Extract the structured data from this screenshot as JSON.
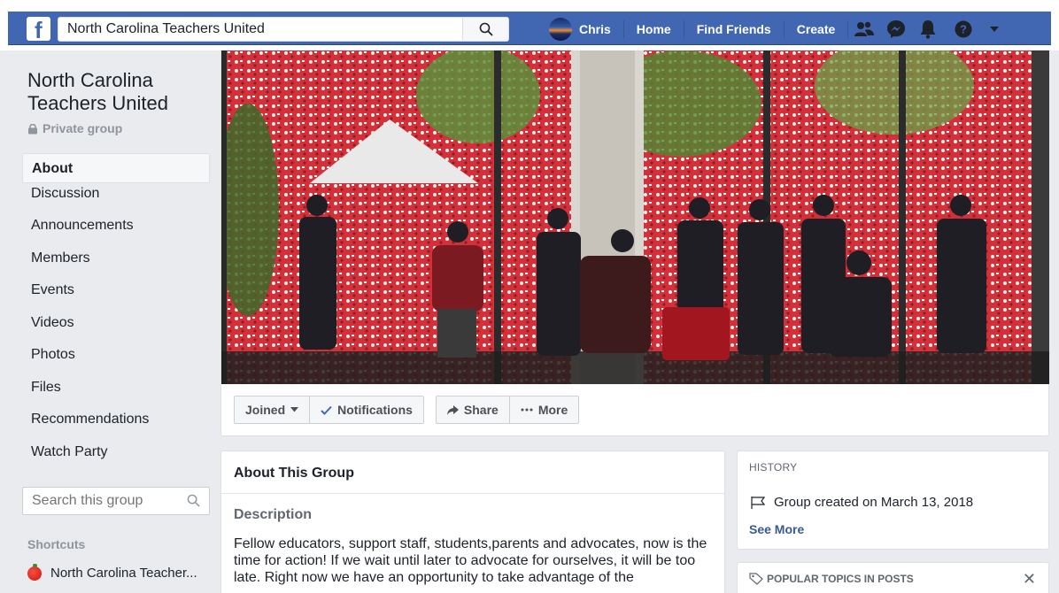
{
  "topbar": {
    "search_value": "North Carolina Teachers United",
    "user_name": "Chris",
    "links": [
      "Home",
      "Find Friends",
      "Create"
    ],
    "brand_color": "#4267b2"
  },
  "group": {
    "name": "North Carolina Teachers United",
    "privacy": "Private group"
  },
  "sidebar": {
    "items": [
      {
        "label": "About",
        "active": true
      },
      {
        "label": "Discussion"
      },
      {
        "label": "Announcements"
      },
      {
        "label": "Members"
      },
      {
        "label": "Events"
      },
      {
        "label": "Videos"
      },
      {
        "label": "Photos"
      },
      {
        "label": "Files"
      },
      {
        "label": "Recommendations"
      },
      {
        "label": "Watch Party"
      }
    ],
    "search_placeholder": "Search this group",
    "shortcuts_heading": "Shortcuts",
    "shortcut_item": "North Carolina Teacher..."
  },
  "actions": {
    "joined": "Joined",
    "notifications": "Notifications",
    "share": "Share",
    "more": "More"
  },
  "about": {
    "heading": "About This Group",
    "description_heading": "Description",
    "description": "Fellow educators, support staff, students,parents and advocates, now is the time for action! If we wait until later to advocate for ourselves, it will be too late. Right now we have an opportunity to take advantage of the"
  },
  "history": {
    "heading": "HISTORY",
    "created": "Group created on March 13, 2018",
    "see_more": "See More"
  },
  "topics": {
    "heading": "POPULAR TOPICS IN POSTS"
  }
}
